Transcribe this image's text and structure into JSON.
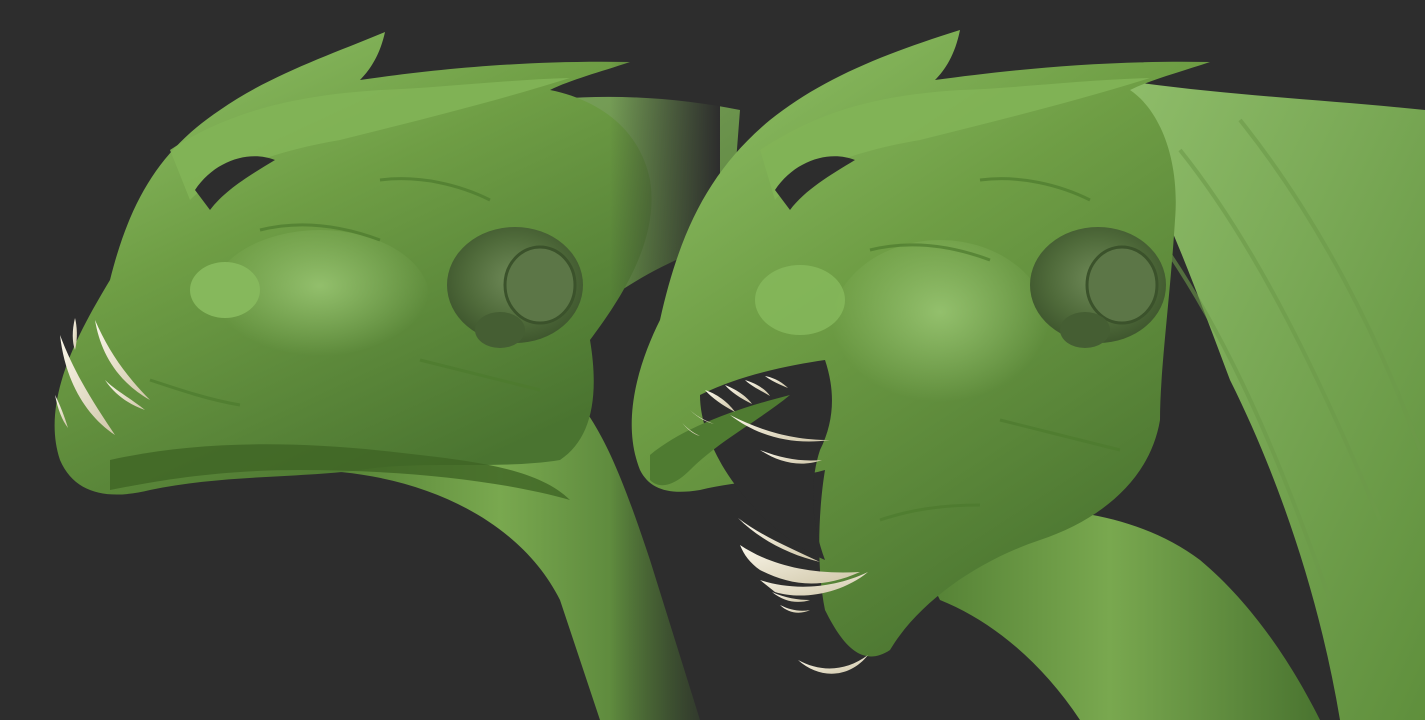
{
  "image": {
    "kind": "3d-sculpt-render",
    "subject": "creature-head-sculpt",
    "views": [
      {
        "name": "mouth-closed-view"
      },
      {
        "name": "mouth-open-view"
      }
    ]
  },
  "colors": {
    "background": "#2d2d2d",
    "skin": "#6f9e45",
    "skin_light": "#93c46a",
    "skin_dark": "#3f6424",
    "ear": "#4f6a3a",
    "teeth": "#e9e2cd"
  }
}
